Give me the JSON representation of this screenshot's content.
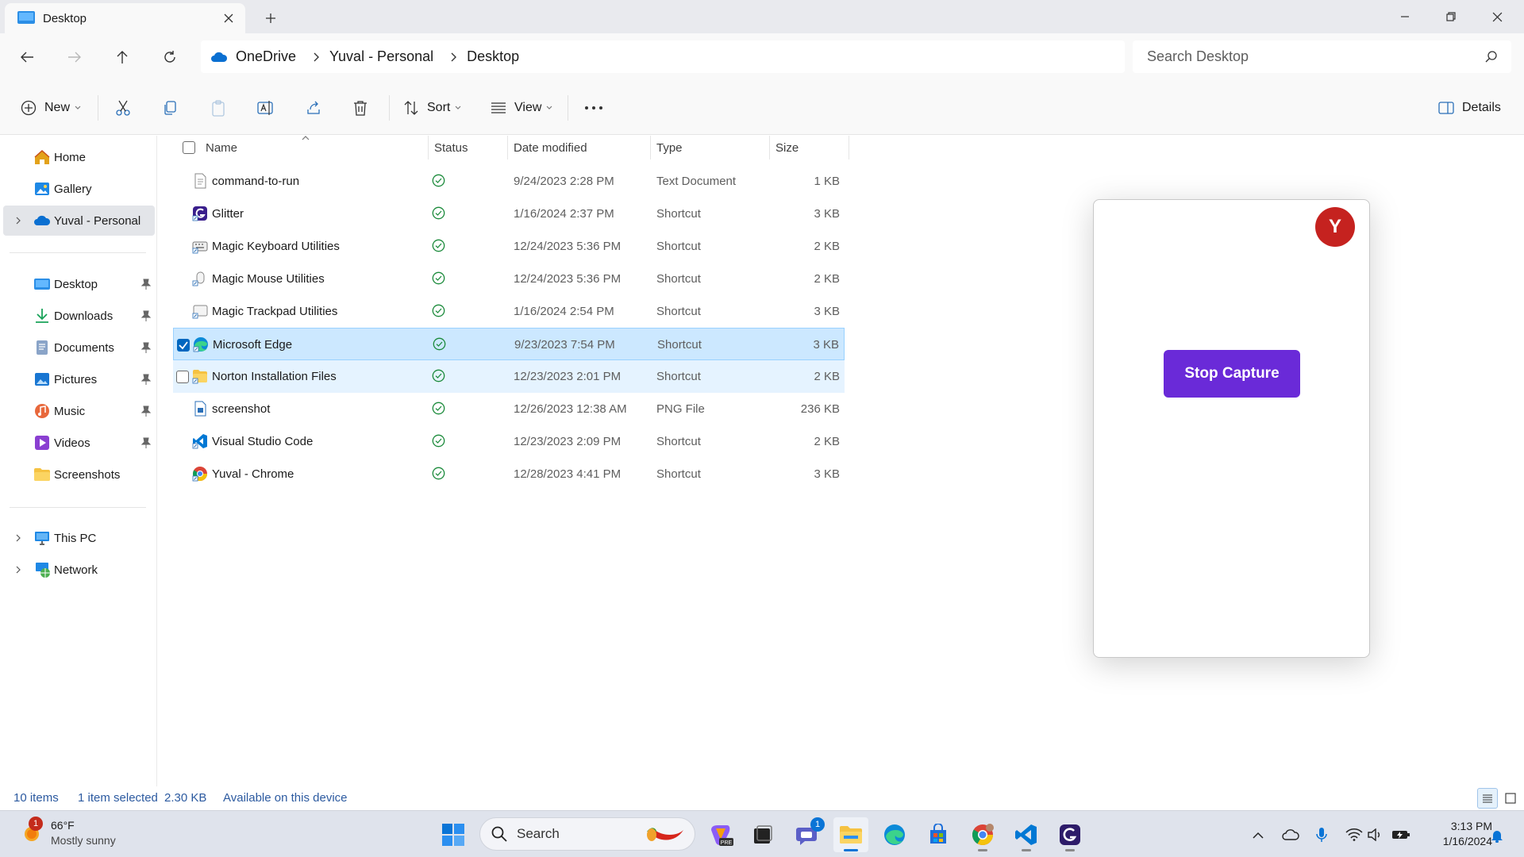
{
  "window": {
    "tab_title": "Desktop",
    "minimize_icon": "minimize-icon",
    "maximize_icon": "restore-icon",
    "close_icon": "close-icon"
  },
  "navigation": {
    "breadcrumb": [
      "OneDrive",
      "Yuval - Personal",
      "Desktop"
    ],
    "search_placeholder": "Search Desktop"
  },
  "commandbar": {
    "new_label": "New",
    "sort_label": "Sort",
    "view_label": "View",
    "details_label": "Details"
  },
  "sidebar": {
    "quick": [
      {
        "label": "Home",
        "icon": "home-icon"
      },
      {
        "label": "Gallery",
        "icon": "gallery-icon"
      },
      {
        "label": "Yuval - Personal",
        "icon": "onedrive-icon",
        "selected": true
      }
    ],
    "pinned": [
      {
        "label": "Desktop",
        "icon": "desktop-folder-icon",
        "pinned": true
      },
      {
        "label": "Downloads",
        "icon": "downloads-icon",
        "pinned": true
      },
      {
        "label": "Documents",
        "icon": "documents-icon",
        "pinned": true
      },
      {
        "label": "Pictures",
        "icon": "pictures-icon",
        "pinned": true
      },
      {
        "label": "Music",
        "icon": "music-icon",
        "pinned": true
      },
      {
        "label": "Videos",
        "icon": "videos-icon",
        "pinned": true
      },
      {
        "label": "Screenshots",
        "icon": "folder-icon",
        "pinned": false
      }
    ],
    "devices": [
      {
        "label": "This PC",
        "icon": "this-pc-icon"
      },
      {
        "label": "Network",
        "icon": "network-icon"
      }
    ]
  },
  "filelist": {
    "columns": [
      "Name",
      "Status",
      "Date modified",
      "Type",
      "Size"
    ],
    "rows": [
      {
        "name": "command-to-run",
        "date": "9/24/2023 2:28 PM",
        "type": "Text Document",
        "size": "1 KB",
        "icon": "text-file-icon"
      },
      {
        "name": "Glitter",
        "date": "1/16/2024 2:37 PM",
        "type": "Shortcut",
        "size": "3 KB",
        "icon": "glitter-icon"
      },
      {
        "name": "Magic Keyboard Utilities",
        "date": "12/24/2023 5:36 PM",
        "type": "Shortcut",
        "size": "2 KB",
        "icon": "keyboard-icon"
      },
      {
        "name": "Magic Mouse Utilities",
        "date": "12/24/2023 5:36 PM",
        "type": "Shortcut",
        "size": "2 KB",
        "icon": "mouse-icon"
      },
      {
        "name": "Magic Trackpad Utilities",
        "date": "1/16/2024 2:54 PM",
        "type": "Shortcut",
        "size": "3 KB",
        "icon": "trackpad-icon"
      },
      {
        "name": "Microsoft Edge",
        "date": "9/23/2023 7:54 PM",
        "type": "Shortcut",
        "size": "3 KB",
        "icon": "edge-icon",
        "selected": true
      },
      {
        "name": "Norton Installation Files",
        "date": "12/23/2023 2:01 PM",
        "type": "Shortcut",
        "size": "2 KB",
        "icon": "folder-shortcut-icon",
        "hover": true
      },
      {
        "name": "screenshot",
        "date": "12/26/2023 12:38 AM",
        "type": "PNG File",
        "size": "236 KB",
        "icon": "image-file-icon"
      },
      {
        "name": "Visual Studio Code",
        "date": "12/23/2023 2:09 PM",
        "type": "Shortcut",
        "size": "2 KB",
        "icon": "vscode-icon"
      },
      {
        "name": "Yuval - Chrome",
        "date": "12/28/2023 4:41 PM",
        "type": "Shortcut",
        "size": "3 KB",
        "icon": "chrome-icon"
      }
    ]
  },
  "capture_panel": {
    "avatar_letter": "Y",
    "stop_button_label": "Stop Capture",
    "accent_color": "#6a2ad8",
    "avatar_color": "#c5221f"
  },
  "statusbar": {
    "item_count": "10 items",
    "selection": "1 item selected",
    "selection_size": "2.30 KB",
    "availability": "Available on this device"
  },
  "taskbar": {
    "weather_temp": "66°F",
    "weather_desc": "Mostly sunny",
    "weather_badge": "1",
    "search_label": "Search",
    "chat_badge": "1",
    "time": "3:13 PM",
    "date": "1/16/2024"
  }
}
